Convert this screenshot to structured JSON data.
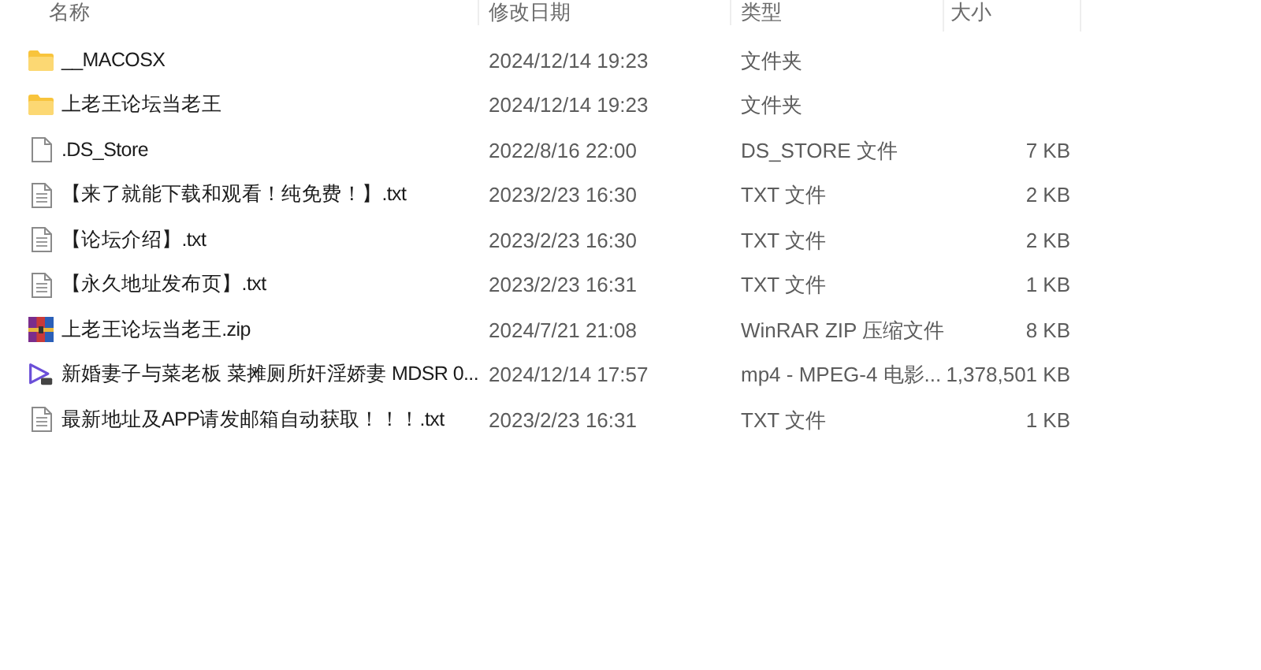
{
  "columns": [
    "名称",
    "修改日期",
    "类型",
    "大小"
  ],
  "files": [
    {
      "kind": "folder",
      "name": "__MACOSX",
      "date": "2024/12/14 19:23",
      "type": "文件夹"
    },
    {
      "kind": "folder",
      "name": "上老王论坛当老王",
      "date": "2024/12/14 19:23",
      "type": "文件夹"
    },
    {
      "kind": "blank",
      "name": ".DS_Store",
      "date": "2022/8/16 22:00",
      "type": "DS_STORE 文件",
      "size": "7 KB"
    },
    {
      "kind": "text",
      "name": "【来了就能下载和观看！纯免费！】.txt",
      "date": "2023/2/23 16:30",
      "type": "TXT 文件",
      "size": "2 KB"
    },
    {
      "kind": "text",
      "name": "【论坛介绍】.txt",
      "date": "2023/2/23 16:30",
      "type": "TXT 文件",
      "size": "2 KB"
    },
    {
      "kind": "text",
      "name": "【永久地址发布页】.txt",
      "date": "2023/2/23 16:31",
      "type": "TXT 文件",
      "size": "1 KB"
    },
    {
      "kind": "archive",
      "name": "上老王论坛当老王.zip",
      "date": "2024/7/21 21:08",
      "type": "WinRAR ZIP 压缩文件",
      "size": "8 KB"
    },
    {
      "kind": "video",
      "name": "新婚妻子与菜老板 菜摊厕所奸淫娇妻 MDSR 0...",
      "date": "2024/12/14 17:57",
      "type": "mp4 - MPEG-4 电影...",
      "size": "1,378,501 KB"
    },
    {
      "kind": "text",
      "name": "最新地址及APP请发邮箱自动获取！！！.txt",
      "date": "2023/2/23 16:31",
      "type": "TXT 文件",
      "size": "1 KB"
    }
  ]
}
